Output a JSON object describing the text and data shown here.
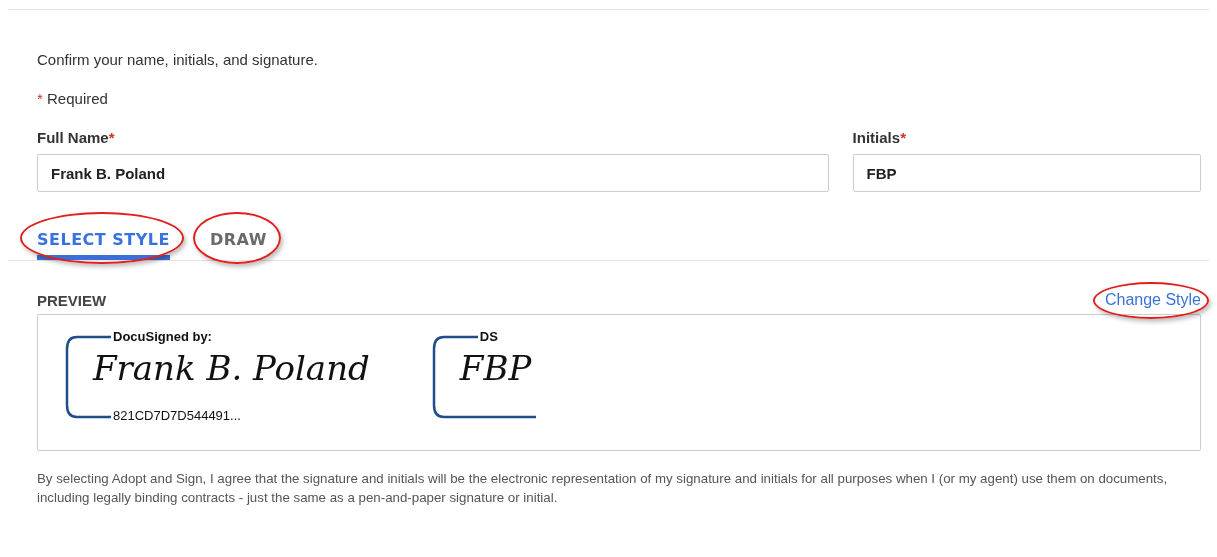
{
  "intro": "Confirm your name, initials, and signature.",
  "required_note": {
    "mark": "*",
    "text": "Required"
  },
  "fields": [
    {
      "label": "Full Name",
      "required_mark": "*",
      "value": "Frank B. Poland",
      "kind": "wide"
    },
    {
      "label": "Initials",
      "required_mark": "*",
      "value": "FBP",
      "kind": "narrow"
    }
  ],
  "tabs": [
    {
      "label": "SELECT STYLE",
      "selected": true,
      "highlighted": true
    },
    {
      "label": "DRAW",
      "selected": false,
      "highlighted": true
    }
  ],
  "preview": {
    "title": "PREVIEW",
    "change_link": {
      "label": "Change Style",
      "highlighted": true
    },
    "signature": {
      "header": "DocuSigned by:",
      "signature": "Frank B. Poland",
      "footer": "821CD7D7D544491..."
    },
    "initials": {
      "header": "DS",
      "signature": "FBP"
    }
  },
  "disclaimer": "By selecting Adopt and Sign, I agree that the signature and initials will be the electronic representation of my signature and initials for all purposes when I (or my agent) use them on documents, including legally binding contracts - just the same as a pen-and-paper signature or initial."
}
